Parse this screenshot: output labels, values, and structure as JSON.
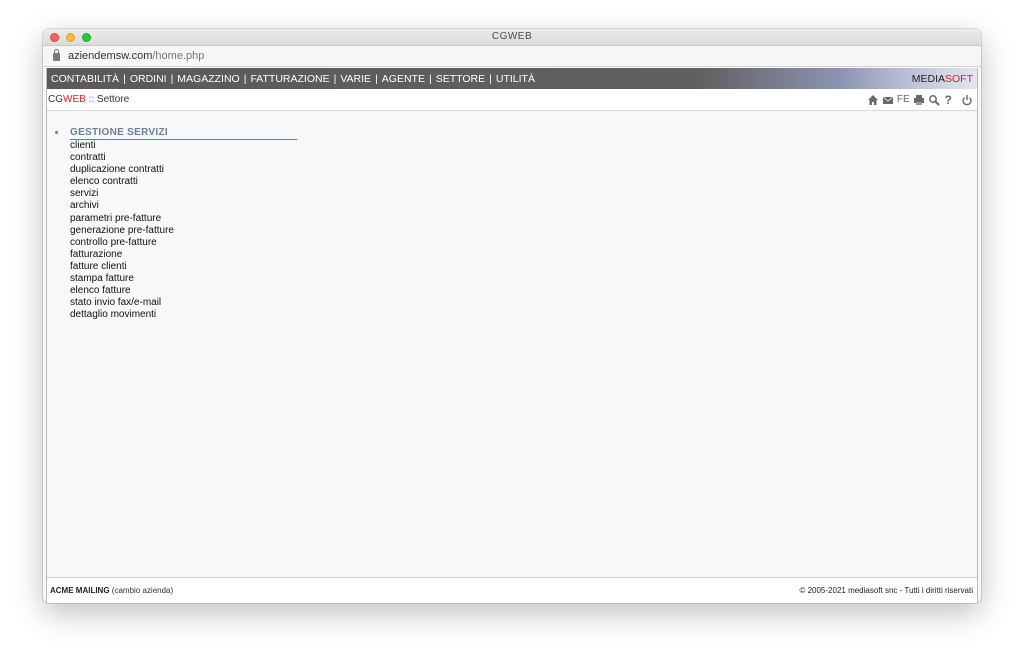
{
  "window": {
    "title": "CGWEB"
  },
  "address": {
    "domain": "aziendemsw.com",
    "path": "/home.php"
  },
  "menu": {
    "items": [
      "CONTABILITÀ",
      "ORDINI",
      "MAGAZZINO",
      "FATTURAZIONE",
      "VARIE",
      "AGENTE",
      "SETTORE",
      "UTILITÀ"
    ],
    "separator": "|",
    "brand_part1": "MEDIA",
    "brand_part2": "SOFT"
  },
  "breadcrumb": {
    "part1": "CG",
    "part2": "WEB",
    "separator": " :: ",
    "page": "Settore"
  },
  "toolbar": {
    "icons": [
      "home-icon",
      "mail-icon",
      "fe-label",
      "print-icon",
      "search-icon",
      "help-icon",
      "power-icon"
    ],
    "fe_label": "FE",
    "help_label": "?"
  },
  "section": {
    "title": "GESTIONE SERVIZI",
    "links": [
      "clienti",
      "contratti",
      "duplicazione contratti",
      "elenco contratti",
      "servizi",
      "archivi",
      "parametri pre-fatture",
      "generazione pre-fatture",
      "controllo pre-fatture",
      "fatturazione",
      "fatture clienti",
      "stampa fatture",
      "elenco fatture",
      "stato invio fax/e-mail",
      "dettaglio movimenti"
    ]
  },
  "footer": {
    "company": "ACME MAILING",
    "change_company": "(cambio azienda)",
    "copyright": "© 2005-2021 mediasoft snc - Tutti i diritti riservati"
  },
  "colors": {
    "accent_red": "#e02020",
    "section_title": "#6a8093",
    "menubar": "#5a5a5a"
  }
}
